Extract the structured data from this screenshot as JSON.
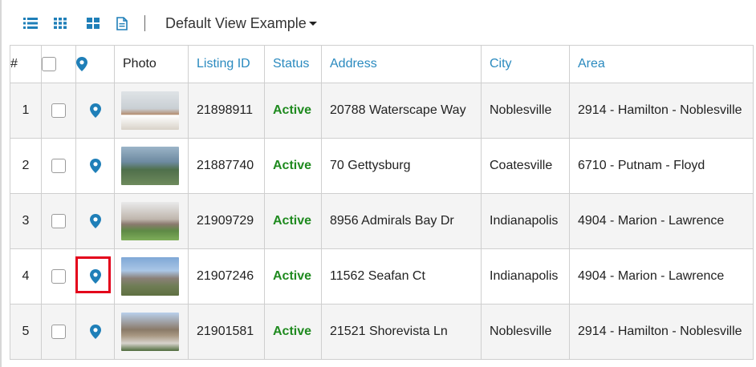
{
  "toolbar": {
    "icons": [
      "list-view-icon",
      "grid-view-icon",
      "tile-view-icon",
      "document-icon"
    ],
    "view_label": "Default View Example",
    "accent_color": "#1f7fb8"
  },
  "table": {
    "headers": {
      "num": "#",
      "photo": "Photo",
      "listing_id": "Listing ID",
      "status": "Status",
      "address": "Address",
      "city": "City",
      "area": "Area"
    },
    "rows": [
      {
        "num": "1",
        "listing_id": "21898911",
        "status": "Active",
        "address": "20788 Waterscape Way",
        "city": "Noblesville",
        "area": "2914 - Hamilton - Noblesville"
      },
      {
        "num": "2",
        "listing_id": "21887740",
        "status": "Active",
        "address": "70 Gettysburg",
        "city": "Coatesville",
        "area": "6710 - Putnam - Floyd"
      },
      {
        "num": "3",
        "listing_id": "21909729",
        "status": "Active",
        "address": "8956 Admirals Bay Dr",
        "city": "Indianapolis",
        "area": "4904 - Marion - Lawrence"
      },
      {
        "num": "4",
        "listing_id": "21907246",
        "status": "Active",
        "address": "11562 Seafan Ct",
        "city": "Indianapolis",
        "area": "4904 - Marion - Lawrence"
      },
      {
        "num": "5",
        "listing_id": "21901581",
        "status": "Active",
        "address": "21521 Shorevista Ln",
        "city": "Noblesville",
        "area": "2914 - Hamilton - Noblesville"
      }
    ]
  },
  "colors": {
    "link": "#2a8abf",
    "status_active": "#1f8a1f",
    "highlight": "#e3001b",
    "pin": "#1f7fb8"
  }
}
